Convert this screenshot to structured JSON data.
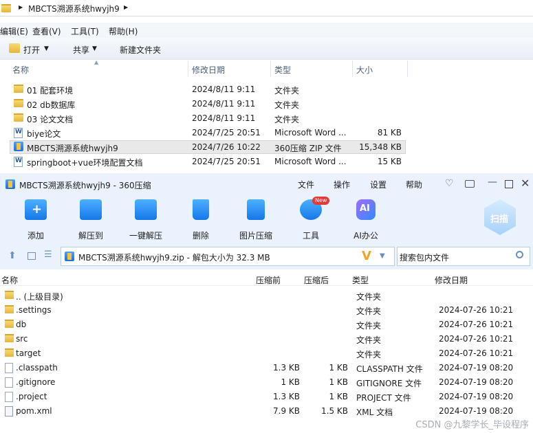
{
  "explorer": {
    "breadcrumb": "MBCTS溯源系统hwyjh9",
    "menu": [
      "编辑(E)",
      "查看(V)",
      "工具(T)",
      "帮助(H)"
    ],
    "toolbar": {
      "open": "打开",
      "share": "共享",
      "new_folder": "新建文件夹"
    },
    "columns": {
      "name": "名称",
      "modified": "修改日期",
      "type": "类型",
      "size": "大小"
    },
    "rows": [
      {
        "name": "01 配套环境",
        "date": "2024/8/11 9:11",
        "type": "文件夹",
        "size": "",
        "icon": "folder-icon"
      },
      {
        "name": "02 db数据库",
        "date": "2024/8/11 9:11",
        "type": "文件夹",
        "size": "",
        "icon": "folder-icon"
      },
      {
        "name": "03 论文文档",
        "date": "2024/8/11 9:11",
        "type": "文件夹",
        "size": "",
        "icon": "folder-icon"
      },
      {
        "name": "biye论文",
        "date": "2024/7/25 20:51",
        "type": "Microsoft Word ...",
        "size": "81 KB",
        "icon": "word-doc-icon"
      },
      {
        "name": "MBCTS溯源系统hwyjh9",
        "date": "2024/7/26 10:22",
        "type": "360压缩 ZIP 文件",
        "size": "15,348 KB",
        "icon": "zip-file-icon"
      },
      {
        "name": "springboot+vue环境配置文档",
        "date": "2024/7/25 20:51",
        "type": "Microsoft Word ...",
        "size": "15 KB",
        "icon": "word-doc-icon"
      }
    ]
  },
  "zip": {
    "title": "MBCTS溯源系统hwyjh9 - 360压缩",
    "top_menu": [
      "文件",
      "操作",
      "设置",
      "帮助"
    ],
    "ribbon": [
      "添加",
      "解压到",
      "一键解压",
      "删除",
      "图片压缩",
      "工具",
      "AI办公"
    ],
    "new_badge": "New",
    "scan_label": "扫描",
    "path": "MBCTS溯源系统hwyjh9.zip - 解包大小为 32.3 MB",
    "search_placeholder": "搜索包内文件",
    "columns": {
      "name": "名称",
      "before": "压缩前",
      "after": "压缩后",
      "type": "类型",
      "modified": "修改日期"
    },
    "rows": [
      {
        "name": ".. (上级目录)",
        "before": "",
        "after": "",
        "type": "文件夹",
        "date": "",
        "icon": "folder-icon"
      },
      {
        "name": ".settings",
        "before": "",
        "after": "",
        "type": "文件夹",
        "date": "2024-07-26 10:21",
        "icon": "folder-icon"
      },
      {
        "name": "db",
        "before": "",
        "after": "",
        "type": "文件夹",
        "date": "2024-07-26 10:21",
        "icon": "folder-icon"
      },
      {
        "name": "src",
        "before": "",
        "after": "",
        "type": "文件夹",
        "date": "2024-07-26 10:21",
        "icon": "folder-icon"
      },
      {
        "name": "target",
        "before": "",
        "after": "",
        "type": "文件夹",
        "date": "2024-07-26 10:21",
        "icon": "folder-icon"
      },
      {
        "name": ".classpath",
        "before": "1.3 KB",
        "after": "1 KB",
        "type": "CLASSPATH 文件",
        "date": "2024-07-19 08:20",
        "icon": "file-icon"
      },
      {
        "name": ".gitignore",
        "before": "1 KB",
        "after": "1 KB",
        "type": "GITIGNORE 文件",
        "date": "2024-07-19 08:20",
        "icon": "file-icon"
      },
      {
        "name": ".project",
        "before": "1.3 KB",
        "after": "1 KB",
        "type": "PROJECT 文件",
        "date": "2024-07-19 08:20",
        "icon": "file-icon"
      },
      {
        "name": "pom.xml",
        "before": "7.9 KB",
        "after": "1.5 KB",
        "type": "XML 文档",
        "date": "2024-07-19 08:20",
        "icon": "xml-file-icon"
      }
    ]
  },
  "watermark": "CSDN @九黎学长_毕设程序"
}
